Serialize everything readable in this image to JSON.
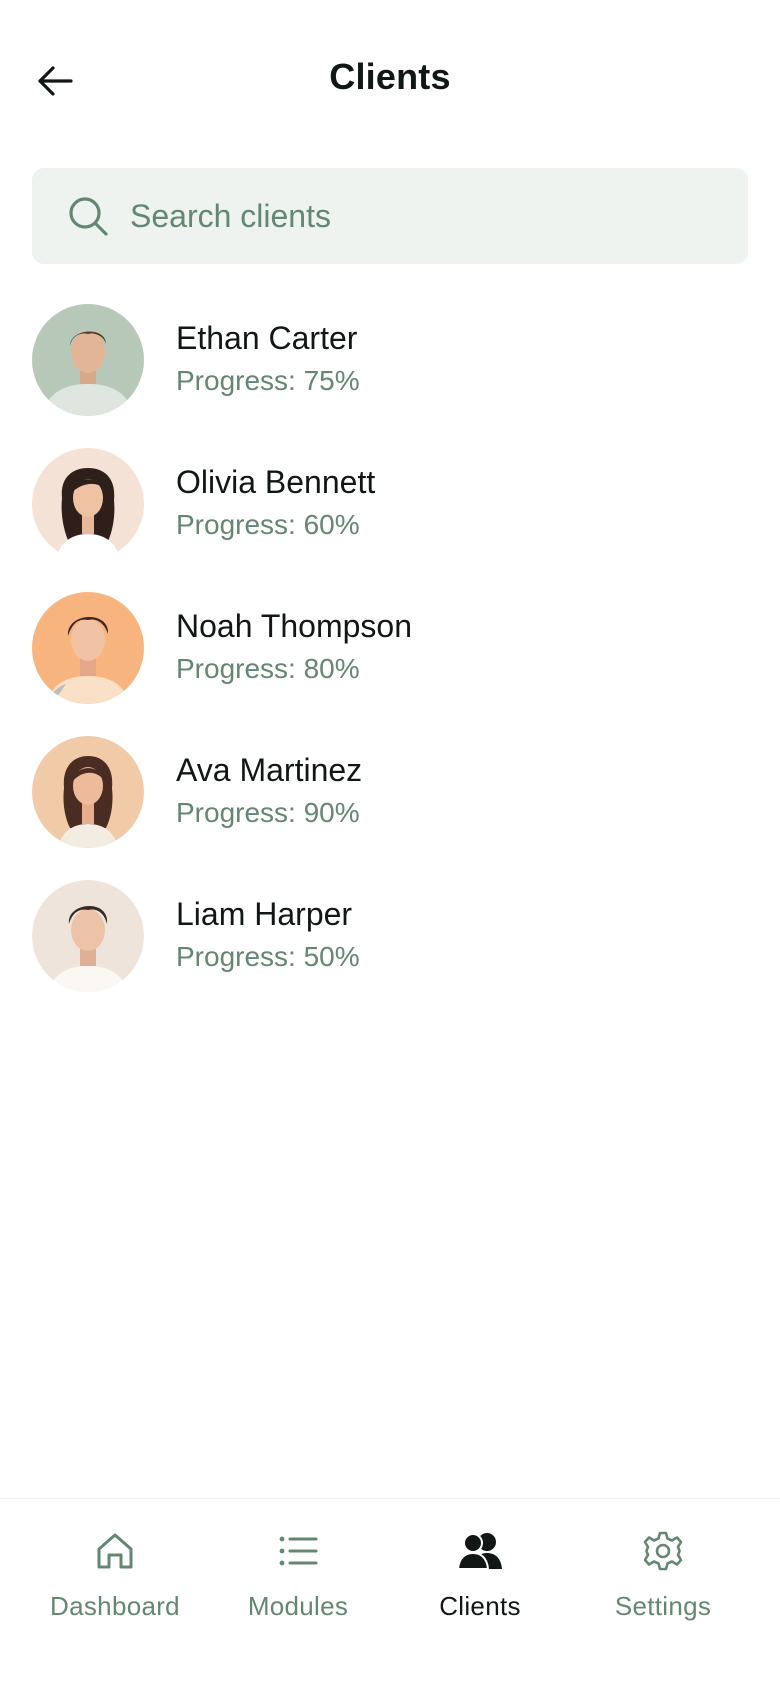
{
  "header": {
    "title": "Clients",
    "back_icon": "arrow-left-icon"
  },
  "search": {
    "placeholder": "Search clients",
    "value": "",
    "icon": "search-icon"
  },
  "clients": [
    {
      "name": "Ethan Carter",
      "progress": "Progress: 75%",
      "avatar_bg": "#b7c7b8"
    },
    {
      "name": "Olivia Bennett",
      "progress": "Progress: 60%",
      "avatar_bg": "#f5e2d6"
    },
    {
      "name": "Noah Thompson",
      "progress": "Progress: 80%",
      "avatar_bg": "#f7b47e"
    },
    {
      "name": "Ava Martinez",
      "progress": "Progress: 90%",
      "avatar_bg": "#f1cba8"
    },
    {
      "name": "Liam Harper",
      "progress": "Progress: 50%",
      "avatar_bg": "#efe4dc"
    }
  ],
  "nav": {
    "items": [
      {
        "label": "Dashboard",
        "icon": "home-icon",
        "active": false
      },
      {
        "label": "Modules",
        "icon": "list-icon",
        "active": false
      },
      {
        "label": "Clients",
        "icon": "users-icon",
        "active": true
      },
      {
        "label": "Settings",
        "icon": "gear-icon",
        "active": false
      }
    ]
  },
  "colors": {
    "text_primary": "#111714",
    "text_secondary": "#648772",
    "search_bg": "#eef3f0"
  }
}
